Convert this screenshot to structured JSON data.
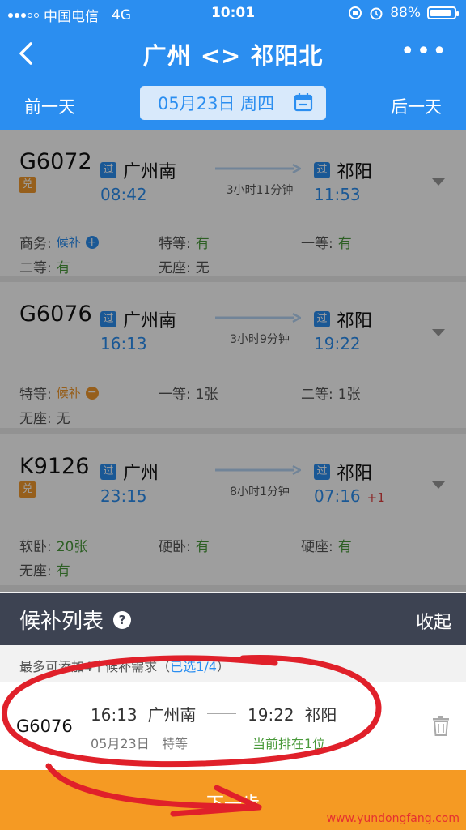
{
  "status_bar": {
    "carrier": "中国电信",
    "network": "4G",
    "time": "10:01",
    "battery": "88%",
    "battery_level": 0.88
  },
  "nav": {
    "title": "广州 <> 祁阳北"
  },
  "date_bar": {
    "prev": "前一天",
    "date": "05月23日 周四",
    "next": "后一天"
  },
  "trains": [
    {
      "number": "G6072",
      "badge": "兑",
      "dep_tag": "过",
      "dep_station": "广州南",
      "dep_time": "08:42",
      "duration": "3小时11分钟",
      "arr_tag": "过",
      "arr_station": "祁阳",
      "arr_time": "11:53",
      "seats": [
        {
          "name": "商务:",
          "value": "候补",
          "kind": "houbu-plus"
        },
        {
          "name": "特等:",
          "value": "有",
          "kind": "green"
        },
        {
          "name": "一等:",
          "value": "有",
          "kind": "green"
        },
        {
          "name": "二等:",
          "value": "有",
          "kind": "green"
        },
        {
          "name": "无座:",
          "value": "无",
          "kind": "gray"
        }
      ]
    },
    {
      "number": "G6076",
      "dep_tag": "过",
      "dep_station": "广州南",
      "dep_time": "16:13",
      "duration": "3小时9分钟",
      "arr_tag": "过",
      "arr_station": "祁阳",
      "arr_time": "19:22",
      "seats": [
        {
          "name": "特等:",
          "value": "候补",
          "kind": "houbu-minus"
        },
        {
          "name": "一等:",
          "value": "1张",
          "kind": "gray"
        },
        {
          "name": "二等:",
          "value": "1张",
          "kind": "gray"
        },
        {
          "name": "无座:",
          "value": "无",
          "kind": "gray"
        }
      ]
    },
    {
      "number": "K9126",
      "badge": "兑",
      "dep_tag": "过",
      "dep_station": "广州",
      "dep_time": "23:15",
      "duration": "8小时1分钟",
      "arr_tag": "过",
      "arr_station": "祁阳",
      "arr_time": "07:16",
      "arr_day_offset": "+1",
      "seats": [
        {
          "name": "软卧:",
          "value": "20张",
          "kind": "green"
        },
        {
          "name": "硬卧:",
          "value": "有",
          "kind": "green"
        },
        {
          "name": "硬座:",
          "value": "有",
          "kind": "green"
        },
        {
          "name": "无座:",
          "value": "有",
          "kind": "green"
        }
      ]
    }
  ],
  "panel": {
    "title": "候补列表",
    "help": "?",
    "collapse": "收起",
    "hint": "最多可添加4个候补需求（",
    "hint_selected": "已选1/4",
    "hint_end": "）"
  },
  "candidate": {
    "number": "G6076",
    "dep_time": "16:13",
    "dep_station": "广州南",
    "arr_time": "19:22",
    "arr_station": "祁阳",
    "date": "05月23日",
    "seat_class": "特等",
    "rank": "当前排在1位"
  },
  "next_button": "下一步",
  "watermark": "www.yundongfang.com",
  "colors": {
    "primary": "#2b8ef0",
    "accent_orange": "#f59a23",
    "available_green": "#4a9a3b",
    "annotation_red": "#e0202a"
  }
}
